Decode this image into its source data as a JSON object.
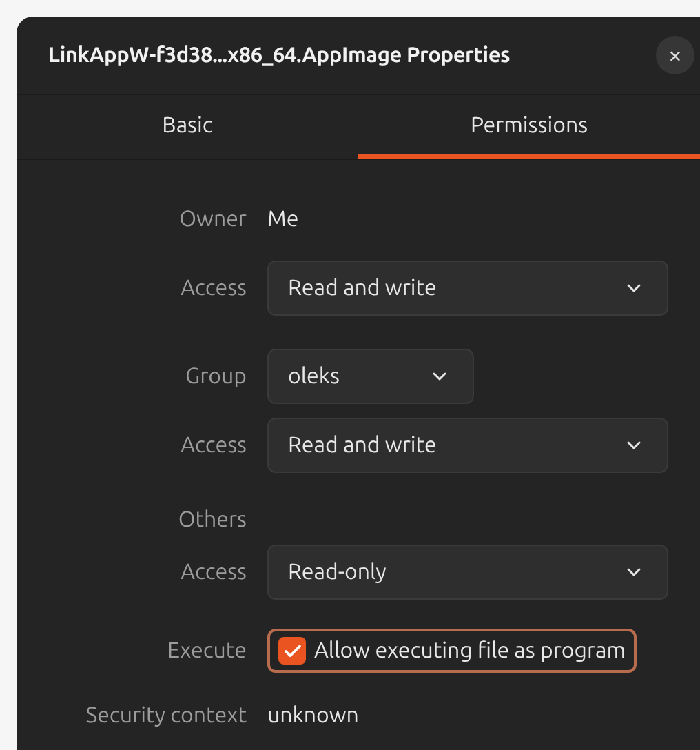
{
  "window": {
    "title": "LinkAppW-f3d38...x86_64.AppImage Properties",
    "close": "×"
  },
  "tabs": [
    {
      "label": "Basic",
      "selected": false
    },
    {
      "label": "Permissions",
      "selected": true
    }
  ],
  "rows": [
    {
      "kind": "text",
      "label": "Owner",
      "value": "Me"
    },
    {
      "kind": "dropdown",
      "label": "Access",
      "value": "Read and write"
    },
    {
      "kind": "dropdown_small",
      "label": "Group",
      "value": "oleks"
    },
    {
      "kind": "dropdown",
      "label": "Access",
      "value": "Read and write"
    },
    {
      "kind": "heading",
      "label": "Others"
    },
    {
      "kind": "dropdown",
      "label": "Access",
      "value": "Read-only"
    },
    {
      "kind": "checkbox",
      "label": "Execute",
      "value": "Allow executing file as program",
      "checked": true
    },
    {
      "kind": "text",
      "label": "Security context",
      "value": "unknown"
    }
  ]
}
